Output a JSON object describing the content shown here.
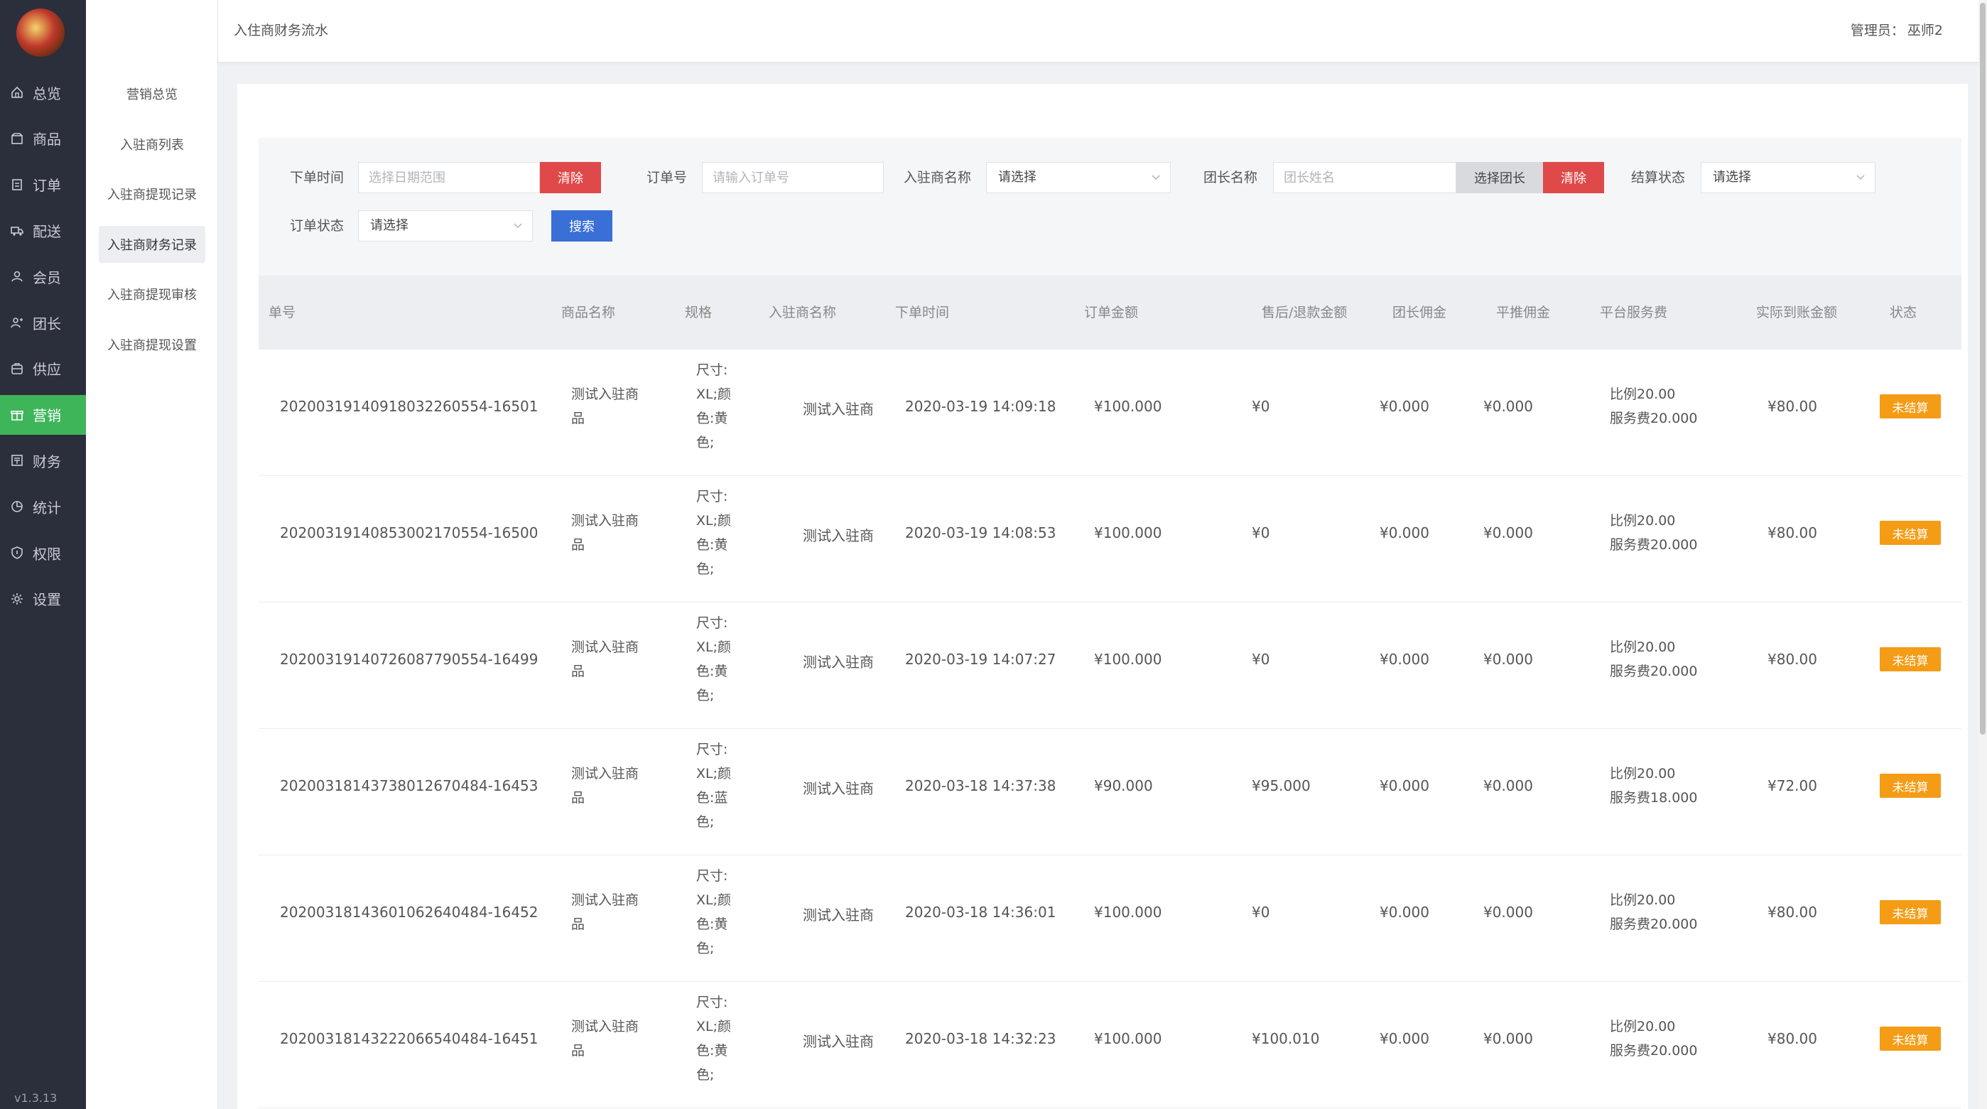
{
  "nav": {
    "version": "v1.3.13",
    "items": [
      {
        "label": "总览",
        "icon": "home-icon"
      },
      {
        "label": "商品",
        "icon": "box-icon"
      },
      {
        "label": "订单",
        "icon": "order-icon"
      },
      {
        "label": "配送",
        "icon": "truck-icon"
      },
      {
        "label": "会员",
        "icon": "user-icon"
      },
      {
        "label": "团长",
        "icon": "leader-icon"
      },
      {
        "label": "供应",
        "icon": "supply-icon"
      },
      {
        "label": "营销",
        "icon": "gift-icon"
      },
      {
        "label": "财务",
        "icon": "finance-icon"
      },
      {
        "label": "统计",
        "icon": "chart-icon"
      },
      {
        "label": "权限",
        "icon": "shield-icon"
      },
      {
        "label": "设置",
        "icon": "gear-icon"
      }
    ],
    "active_index": 7
  },
  "submenu": {
    "items": [
      {
        "label": "营销总览"
      },
      {
        "label": "入驻商列表"
      },
      {
        "label": "入驻商提现记录"
      },
      {
        "label": "入驻商财务记录"
      },
      {
        "label": "入驻商提现审核"
      },
      {
        "label": "入驻商提现设置"
      }
    ],
    "active_index": 3
  },
  "header": {
    "title": "入住商财务流水",
    "admin_label": "管理员：",
    "admin_name": "巫师2"
  },
  "filter": {
    "order_time_label": "下单时间",
    "order_time_placeholder": "选择日期范围",
    "clear_label": "清除",
    "order_no_label": "订单号",
    "order_no_placeholder": "请输入订单号",
    "merchant_label": "入驻商名称",
    "merchant_value": "请选择",
    "leader_label": "团长名称",
    "leader_placeholder": "团长姓名",
    "select_leader_label": "选择团长",
    "settle_status_label": "结算状态",
    "settle_status_value": "请选择",
    "order_status_label": "订单状态",
    "order_status_value": "请选择",
    "search_label": "搜索"
  },
  "table": {
    "headers": [
      "单号",
      "商品名称",
      "规格",
      "入驻商名称",
      "下单时间",
      "订单金额",
      "售后/退款金额",
      "团长佣金",
      "平推佣金",
      "平台服务费",
      "实际到账金额",
      "状态"
    ],
    "rows": [
      {
        "no": "20200319140918032260554-16501",
        "product": [
          "测试入驻商",
          "品"
        ],
        "spec": [
          "尺寸:",
          "XL;颜",
          "色:黄",
          "色;"
        ],
        "merchant": "测试入驻商",
        "time": "2020-03-19 14:09:18",
        "amount": "¥100.000",
        "refund": "¥0",
        "leader_fee": "¥0.000",
        "push_fee": "¥0.000",
        "service": [
          "比例20.00",
          "服务费20.000"
        ],
        "actual": "¥80.00",
        "status": "未结算"
      },
      {
        "no": "20200319140853002170554-16500",
        "product": [
          "测试入驻商",
          "品"
        ],
        "spec": [
          "尺寸:",
          "XL;颜",
          "色:黄",
          "色;"
        ],
        "merchant": "测试入驻商",
        "time": "2020-03-19 14:08:53",
        "amount": "¥100.000",
        "refund": "¥0",
        "leader_fee": "¥0.000",
        "push_fee": "¥0.000",
        "service": [
          "比例20.00",
          "服务费20.000"
        ],
        "actual": "¥80.00",
        "status": "未结算"
      },
      {
        "no": "20200319140726087790554-16499",
        "product": [
          "测试入驻商",
          "品"
        ],
        "spec": [
          "尺寸:",
          "XL;颜",
          "色:黄",
          "色;"
        ],
        "merchant": "测试入驻商",
        "time": "2020-03-19 14:07:27",
        "amount": "¥100.000",
        "refund": "¥0",
        "leader_fee": "¥0.000",
        "push_fee": "¥0.000",
        "service": [
          "比例20.00",
          "服务费20.000"
        ],
        "actual": "¥80.00",
        "status": "未结算"
      },
      {
        "no": "20200318143738012670484-16453",
        "product": [
          "测试入驻商",
          "品"
        ],
        "spec": [
          "尺寸:",
          "XL;颜",
          "色:蓝",
          "色;"
        ],
        "merchant": "测试入驻商",
        "time": "2020-03-18 14:37:38",
        "amount": "¥90.000",
        "refund": "¥95.000",
        "leader_fee": "¥0.000",
        "push_fee": "¥0.000",
        "service": [
          "比例20.00",
          "服务费18.000"
        ],
        "actual": "¥72.00",
        "status": "未结算"
      },
      {
        "no": "20200318143601062640484-16452",
        "product": [
          "测试入驻商",
          "品"
        ],
        "spec": [
          "尺寸:",
          "XL;颜",
          "色:黄",
          "色;"
        ],
        "merchant": "测试入驻商",
        "time": "2020-03-18 14:36:01",
        "amount": "¥100.000",
        "refund": "¥0",
        "leader_fee": "¥0.000",
        "push_fee": "¥0.000",
        "service": [
          "比例20.00",
          "服务费20.000"
        ],
        "actual": "¥80.00",
        "status": "未结算"
      },
      {
        "no": "20200318143222066540484-16451",
        "product": [
          "测试入驻商",
          "品"
        ],
        "spec": [
          "尺寸:",
          "XL;颜",
          "色:黄",
          "色;"
        ],
        "merchant": "测试入驻商",
        "time": "2020-03-18 14:32:23",
        "amount": "¥100.000",
        "refund": "¥100.010",
        "leader_fee": "¥0.000",
        "push_fee": "¥0.000",
        "service": [
          "比例20.00",
          "服务费20.000"
        ],
        "actual": "¥80.00",
        "status": "未结算"
      }
    ]
  },
  "colors": {
    "nav_bg": "#2b2e3b",
    "nav_active": "#3fb55a",
    "clear_button": "#e0494a",
    "search_button": "#3a6fd8",
    "status_badge": "#f49c15"
  }
}
